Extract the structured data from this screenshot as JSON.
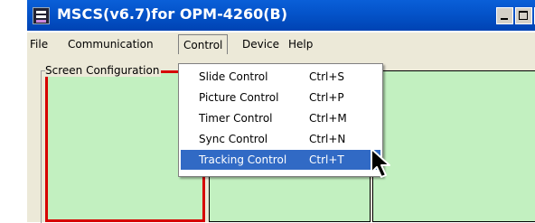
{
  "window": {
    "title": "MSCS(v6.7)for OPM-4260(B)",
    "icon": "app-icon",
    "controls": [
      "minimize",
      "maximize",
      "close"
    ]
  },
  "menubar": {
    "file": "File",
    "communication": "Communication",
    "control": "Control",
    "device": "Device",
    "help": "Help"
  },
  "group": {
    "label": "Screen Configuration"
  },
  "control_menu": {
    "items": [
      {
        "label": "Slide Control",
        "shortcut": "Ctrl+S"
      },
      {
        "label": "Picture Control",
        "shortcut": "Ctrl+P"
      },
      {
        "label": "Timer Control",
        "shortcut": "Ctrl+M"
      },
      {
        "label": "Sync Control",
        "shortcut": "Ctrl+N"
      },
      {
        "label": "Tracking Control",
        "shortcut": "Ctrl+T"
      }
    ],
    "selected_index": 4
  },
  "colors": {
    "title_bar": "#0453c9",
    "pane_fill": "#c2f0c0",
    "active_pane_border": "#d60000",
    "menu_highlight": "#316ac5"
  }
}
